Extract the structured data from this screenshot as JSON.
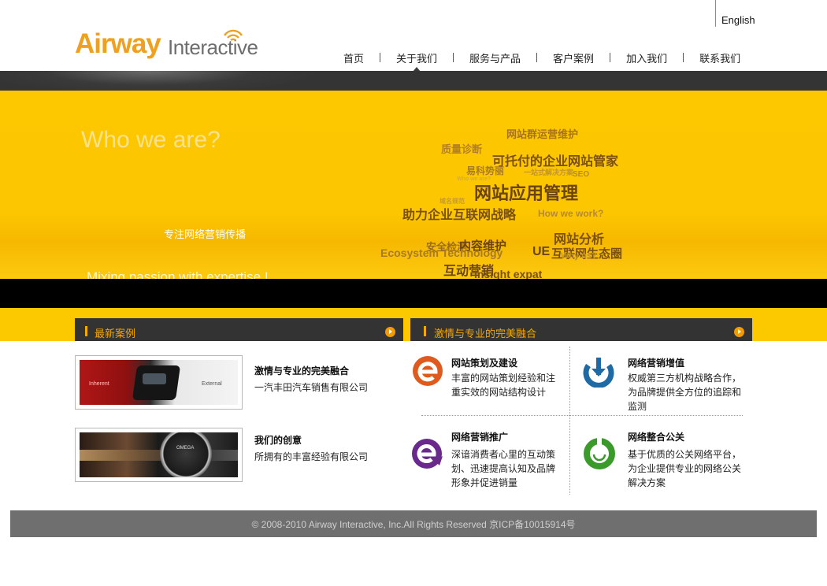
{
  "header": {
    "language_link": "English",
    "logo": {
      "word1": "Airway",
      "word2": "Interactive"
    },
    "nav": [
      {
        "label": "首页"
      },
      {
        "label": "关于我们",
        "active": true
      },
      {
        "label": "服务与产品"
      },
      {
        "label": "客户案例"
      },
      {
        "label": "加入我们"
      },
      {
        "label": "联系我们"
      }
    ]
  },
  "banner": {
    "headline": "Who we are?",
    "tagline": "专注网络营销传播",
    "slogan": "Mixing passion with expertise !",
    "cloud": [
      "网站群运营维护",
      "质量诊断",
      "可托付的企业网站管家",
      "易科势丽",
      "一站式解决方案",
      "SEO",
      "Who we are?",
      "网站应用管理",
      "域名规范",
      "助力企业互联网战略",
      "How we work?",
      "网站分析",
      "安全检测",
      "内容维护",
      "Ecosystem Technology",
      "UE",
      "互联网生态圈",
      "Why us?",
      "互动营销",
      "Insight expat"
    ]
  },
  "cases": {
    "title": "最新案例",
    "items": [
      {
        "title": "激情与专业的完美融合",
        "subtitle": "一汽丰田汽车销售有限公司",
        "thumb_left": "Inherent",
        "thumb_right": "External"
      },
      {
        "title": "我们的创意",
        "subtitle": "所拥有的丰富经验有限公司",
        "thumb_brand": "OMEGA"
      }
    ]
  },
  "services": {
    "title": "激情与专业的完美融合",
    "items": [
      {
        "title": "网站策划及建设",
        "desc": "丰富的网站策划经验和注重实效的网站结构设计",
        "icon": "e-logo-icon",
        "color": "#e05a1e"
      },
      {
        "title": "网络营销增值",
        "desc": "权威第三方机构战略合作，为品牌提供全方位的追踪和监测",
        "icon": "download-arrow-icon",
        "color": "#1e6aa5"
      },
      {
        "title": "网络营销推广",
        "desc": "深谙消费者心里的互动策划、迅速提高认知及品牌形象并促进销量",
        "icon": "e-arrow-icon",
        "color": "#6a2a8c"
      },
      {
        "title": "网络整合公关",
        "desc": "基于优质的公关网络平台，为企业提供专业的网络公关解决方案",
        "icon": "smile-ring-icon",
        "color": "#3a9a2a"
      }
    ]
  },
  "footer": {
    "copyright": "© 2008-2010 Airway Interactive, Inc.All Rights Reserved 京ICP备10015914号"
  },
  "colors": {
    "brand_orange": "#f0a020",
    "banner_yellow": "#fcc800",
    "dark_bar": "#333333",
    "footer_gray": "#6f6f6f"
  }
}
